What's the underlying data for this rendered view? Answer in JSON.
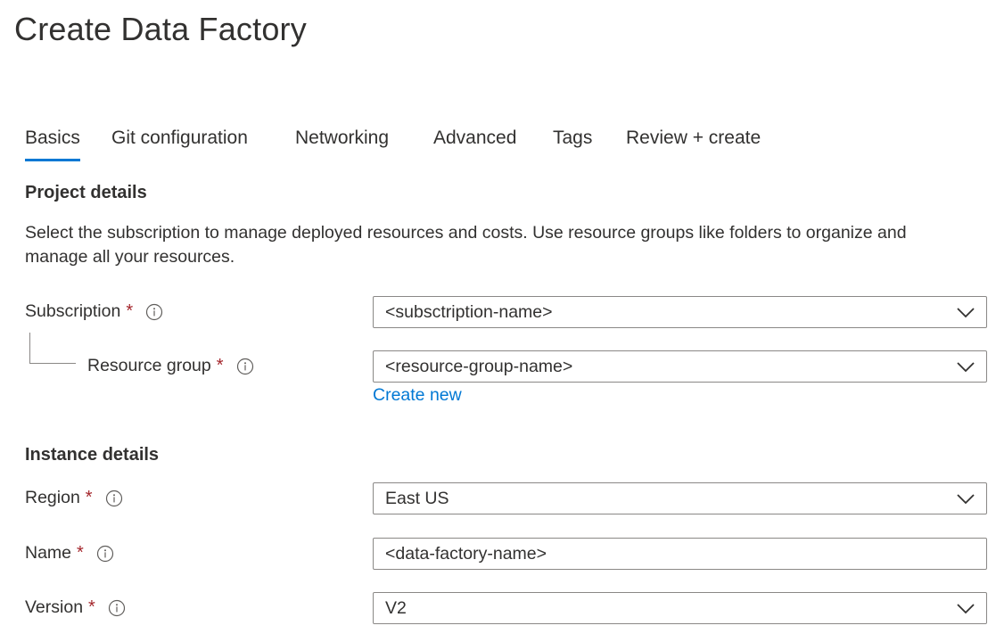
{
  "page": {
    "title": "Create Data Factory"
  },
  "tabs": [
    {
      "label": "Basics"
    },
    {
      "label": "Git configuration"
    },
    {
      "label": "Networking"
    },
    {
      "label": "Advanced"
    },
    {
      "label": "Tags"
    },
    {
      "label": "Review + create"
    }
  ],
  "active_tab": "Basics",
  "project": {
    "heading": "Project details",
    "description": "Select the subscription to manage deployed resources and costs. Use resource groups like folders to organize and manage all your resources.",
    "subscription": {
      "label": "Subscription",
      "required": "*",
      "value": "<subsctription-name>"
    },
    "resource_group": {
      "label": "Resource group",
      "required": "*",
      "value": "<resource-group-name>",
      "create_new": "Create new"
    }
  },
  "instance": {
    "heading": "Instance details",
    "region": {
      "label": "Region",
      "required": "*",
      "value": "East US"
    },
    "name": {
      "label": "Name",
      "required": "*",
      "value": "<data-factory-name>"
    },
    "version": {
      "label": "Version",
      "required": "*",
      "value": "V2"
    }
  },
  "colors": {
    "accent": "#0078d4",
    "required": "#a4262c",
    "text": "#323130",
    "border": "#8a8886"
  },
  "icons": {
    "info": "info-icon",
    "dropdown": "chevron-down-icon"
  }
}
